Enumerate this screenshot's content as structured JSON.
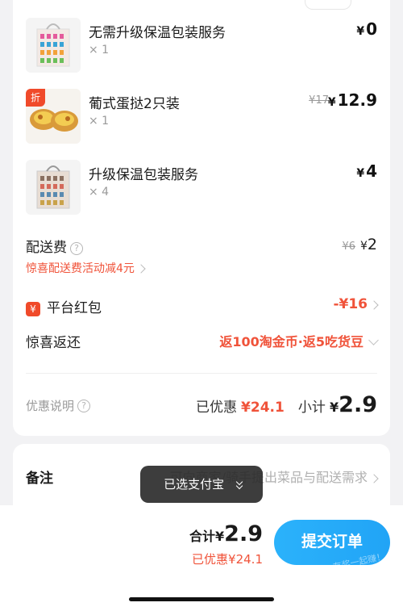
{
  "items": [
    {
      "name": "无需升级保温包装服务",
      "qty": "× 1",
      "price": "0",
      "orig": "",
      "tag": ""
    },
    {
      "name": "葡式蛋挞2只装",
      "qty": "× 1",
      "price": "12.9",
      "orig": "¥17",
      "tag": "折"
    },
    {
      "name": "升级保温包装服务",
      "qty": "× 4",
      "price": "4",
      "orig": "",
      "tag": ""
    }
  ],
  "currency": "¥",
  "delivery": {
    "label": "配送费",
    "orig": "¥6",
    "price": "2",
    "promo": "惊喜配送费活动减4元"
  },
  "redpacket": {
    "label": "平台红包",
    "value": "-¥16"
  },
  "cashback": {
    "label": "惊喜返还",
    "value": "返100淘金币·返5吃货豆"
  },
  "summary": {
    "note_label": "优惠说明",
    "discount_label": "已优惠",
    "discount_value": "¥24.1",
    "subtotal_label": "小计",
    "subtotal_value": "2.9"
  },
  "remark": {
    "label": "备注",
    "placeholder": "可向商家/骑手提出菜品与配送需求"
  },
  "toast": {
    "text": "已选支付宝"
  },
  "footer": {
    "total_label": "合计",
    "total_value": "2.9",
    "saved_text": "已优惠¥24.1",
    "submit_label": "提交订单"
  },
  "watermark": "赚客吧，有奖一起赚！ www.zuanke8.com",
  "colors": {
    "accent_red": "#f0533a",
    "accent_blue": "#22a7f7"
  }
}
